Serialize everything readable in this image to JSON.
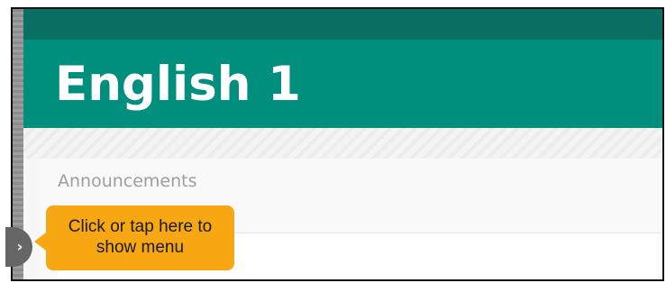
{
  "course": {
    "title": "English 1"
  },
  "content": {
    "section_label": "Announcements"
  },
  "menu_toggle": {
    "icon": "chevron-right-icon",
    "glyph": "›"
  },
  "tooltip": {
    "line1": "Click or tap here to",
    "line2": "show menu"
  },
  "colors": {
    "header": "#008f7d",
    "top_strip": "#0a6f63",
    "tooltip": "#f6a712",
    "toggle": "#666666"
  }
}
